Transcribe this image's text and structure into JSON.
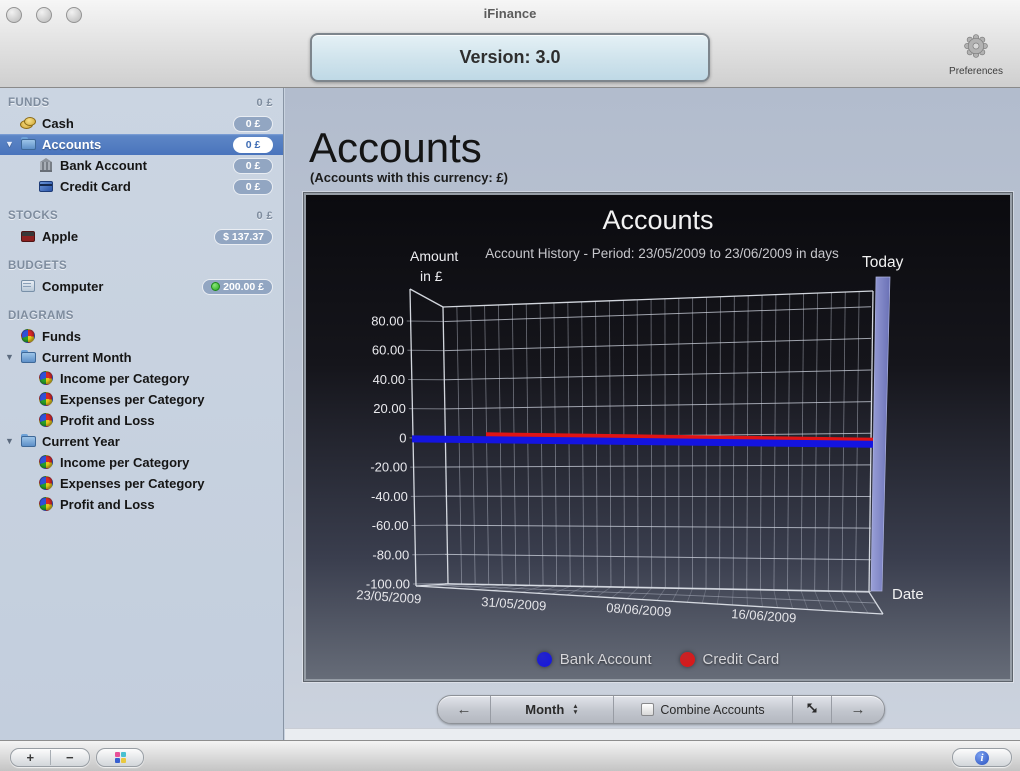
{
  "window": {
    "title": "iFinance",
    "version_button": "Version: 3.0",
    "preferences_label": "Preferences",
    "traffic_lights": [
      "close",
      "minimize",
      "zoom"
    ]
  },
  "sidebar": {
    "sections": [
      {
        "label": "FUNDS",
        "badge": "0 £",
        "items": [
          {
            "label": "Cash",
            "icon": "coins-icon",
            "badge": "0 £",
            "indent": 1
          },
          {
            "label": "Accounts",
            "icon": "folder-icon",
            "badge": "0 £",
            "indent": 1,
            "selected": true,
            "expandable": true
          },
          {
            "label": "Bank Account",
            "icon": "bank-icon",
            "badge": "0 £",
            "indent": 2
          },
          {
            "label": "Credit Card",
            "icon": "credit-card-icon",
            "badge": "0 £",
            "indent": 2
          }
        ]
      },
      {
        "label": "STOCKS",
        "badge": "0 £",
        "items": [
          {
            "label": "Apple",
            "icon": "stock-icon",
            "badge": "$ 137.37",
            "indent": 1
          }
        ]
      },
      {
        "label": "BUDGETS",
        "items": [
          {
            "label": "Computer",
            "icon": "budget-icon",
            "badge": "200.00 £",
            "badge_dot": true,
            "indent": 1
          }
        ]
      },
      {
        "label": "DIAGRAMS",
        "items": [
          {
            "label": "Funds",
            "icon": "pie-icon",
            "indent": 1
          },
          {
            "label": "Current Month",
            "icon": "folder-icon",
            "indent": 1,
            "expandable": true
          },
          {
            "label": "Income per Category",
            "icon": "pie-icon",
            "indent": 2
          },
          {
            "label": "Expenses per Category",
            "icon": "pie-icon",
            "indent": 2
          },
          {
            "label": "Profit and Loss",
            "icon": "pie-icon",
            "indent": 2
          },
          {
            "label": "Current Year",
            "icon": "folder-icon",
            "indent": 1,
            "expandable": true
          },
          {
            "label": "Income per Category",
            "icon": "pie-icon",
            "indent": 2
          },
          {
            "label": "Expenses per Category",
            "icon": "pie-icon",
            "indent": 2
          },
          {
            "label": "Profit and Loss",
            "icon": "pie-icon",
            "indent": 2
          }
        ]
      }
    ]
  },
  "main": {
    "title": "Accounts",
    "subtitle": "(Accounts with this currency: £)"
  },
  "chart_data": {
    "type": "line",
    "projection": "3d",
    "title": "Accounts",
    "subtitle": "Account History - Period: 23/05/2009 to 23/06/2009 in days",
    "ylabel": "Amount in £",
    "ylabel_lines": [
      "Amount",
      "in £"
    ],
    "xlabel": "Date",
    "ylim": [
      -100,
      100
    ],
    "yticks": [
      "80.00",
      "60.00",
      "40.00",
      "20.00",
      "0",
      "-20.00",
      "-40.00",
      "-60.00",
      "-80.00",
      "-100.00"
    ],
    "ytick_values": [
      80,
      60,
      40,
      20,
      0,
      -20,
      -40,
      -60,
      -80,
      -100
    ],
    "xticks": [
      "23/05/2009",
      "31/05/2009",
      "08/06/2009",
      "16/06/2009"
    ],
    "x_range": [
      "23/05/2009",
      "23/06/2009"
    ],
    "series": [
      {
        "name": "Bank Account",
        "color": "#1414e0",
        "values": [
          0,
          0
        ]
      },
      {
        "name": "Credit Card",
        "color": "#e01414",
        "values": [
          3,
          3
        ]
      }
    ],
    "annotations": [
      "Today"
    ],
    "today_bar_color": "#7d84c8",
    "legend_position": "bottom",
    "grid": true
  },
  "controls": {
    "prev": "←",
    "period": "Month",
    "combine_label": "Combine Accounts",
    "combine_checked": false,
    "next": "→"
  },
  "bottom_bar": {
    "add": "+",
    "remove": "−",
    "info": "i"
  },
  "colors": {
    "sidebar_selection": "#4a74bc",
    "badge_pill": "#92a6c2",
    "budget_dot": "#35c02c",
    "chart_bg_top": "#0b0b0f",
    "chart_bg_bottom": "#666c78"
  }
}
